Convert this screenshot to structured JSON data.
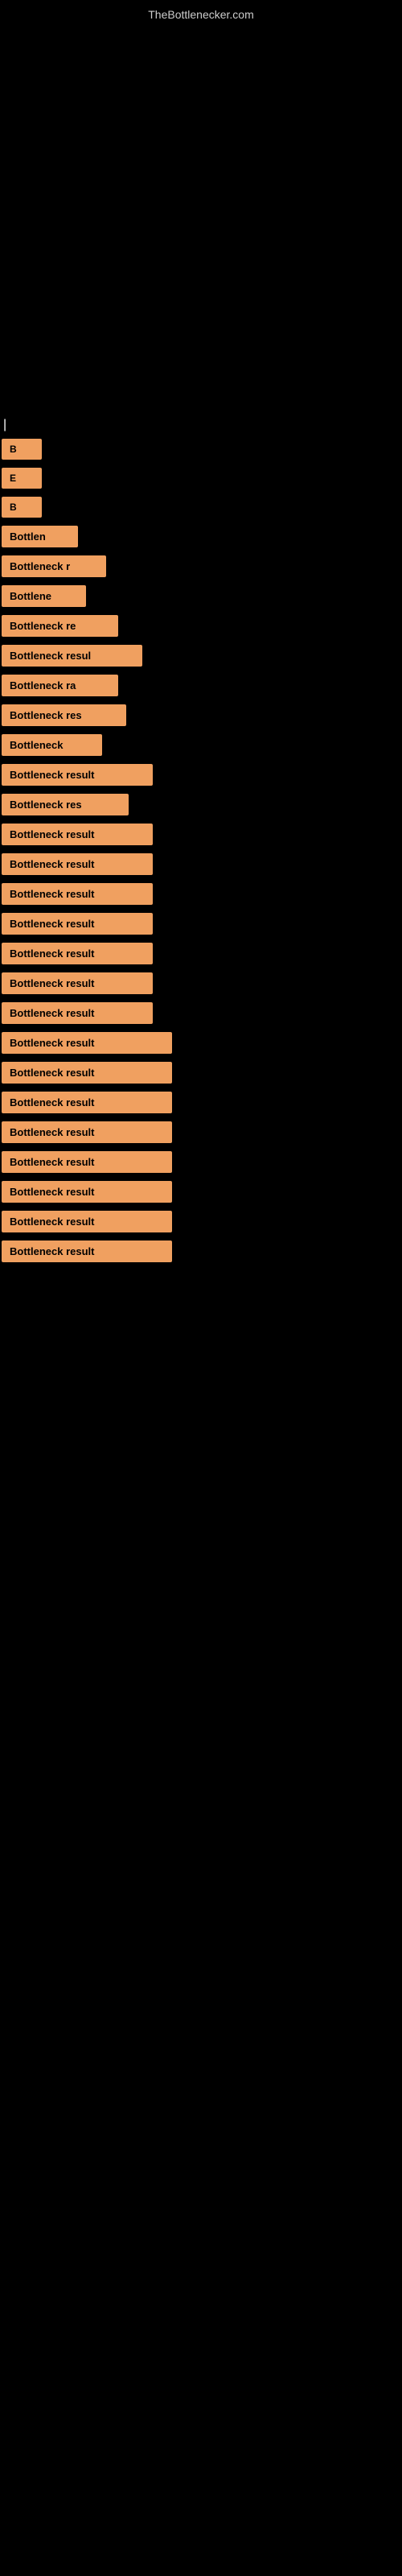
{
  "header": {
    "site_name": "TheBottlenecker.com"
  },
  "results": [
    {
      "id": 1,
      "label": "B",
      "short": true,
      "width": 30
    },
    {
      "id": 2,
      "label": "E",
      "short": true,
      "width": 30
    },
    {
      "id": 3,
      "label": "B",
      "short": true,
      "width": 30
    },
    {
      "id": 4,
      "label": "Bottlen",
      "short": true,
      "width": 75
    },
    {
      "id": 5,
      "label": "Bottleneck r",
      "short": true,
      "width": 110
    },
    {
      "id": 6,
      "label": "Bottlene",
      "short": true,
      "width": 85
    },
    {
      "id": 7,
      "label": "Bottleneck re",
      "short": true,
      "width": 125
    },
    {
      "id": 8,
      "label": "Bottleneck resul",
      "short": false,
      "width": 155
    },
    {
      "id": 9,
      "label": "Bottleneck ra",
      "short": true,
      "width": 125
    },
    {
      "id": 10,
      "label": "Bottleneck res",
      "short": true,
      "width": 135
    },
    {
      "id": 11,
      "label": "Bottleneck",
      "short": true,
      "width": 105
    },
    {
      "id": 12,
      "label": "Bottleneck result",
      "short": false,
      "width": 168
    },
    {
      "id": 13,
      "label": "Bottleneck res",
      "short": true,
      "width": 138
    },
    {
      "id": 14,
      "label": "Bottleneck result",
      "short": false,
      "width": 168
    },
    {
      "id": 15,
      "label": "Bottleneck result",
      "short": false,
      "width": 168
    },
    {
      "id": 16,
      "label": "Bottleneck result",
      "short": false,
      "width": 168
    },
    {
      "id": 17,
      "label": "Bottleneck result",
      "short": false,
      "width": 168
    },
    {
      "id": 18,
      "label": "Bottleneck result",
      "short": false,
      "width": 168
    },
    {
      "id": 19,
      "label": "Bottleneck result",
      "short": false,
      "width": 168
    },
    {
      "id": 20,
      "label": "Bottleneck result",
      "short": false,
      "width": 168
    },
    {
      "id": 21,
      "label": "Bottleneck result",
      "short": false,
      "width": 192
    },
    {
      "id": 22,
      "label": "Bottleneck result",
      "short": false,
      "width": 192
    },
    {
      "id": 23,
      "label": "Bottleneck result",
      "short": false,
      "width": 192
    },
    {
      "id": 24,
      "label": "Bottleneck result",
      "short": false,
      "width": 192
    },
    {
      "id": 25,
      "label": "Bottleneck result",
      "short": false,
      "width": 192
    },
    {
      "id": 26,
      "label": "Bottleneck result",
      "short": false,
      "width": 192
    },
    {
      "id": 27,
      "label": "Bottleneck result",
      "short": false,
      "width": 192
    },
    {
      "id": 28,
      "label": "Bottleneck result",
      "short": false,
      "width": 192
    }
  ],
  "colors": {
    "background": "#000000",
    "badge": "#f0a060",
    "text": "#ffffff",
    "header_text": "#cccccc"
  }
}
